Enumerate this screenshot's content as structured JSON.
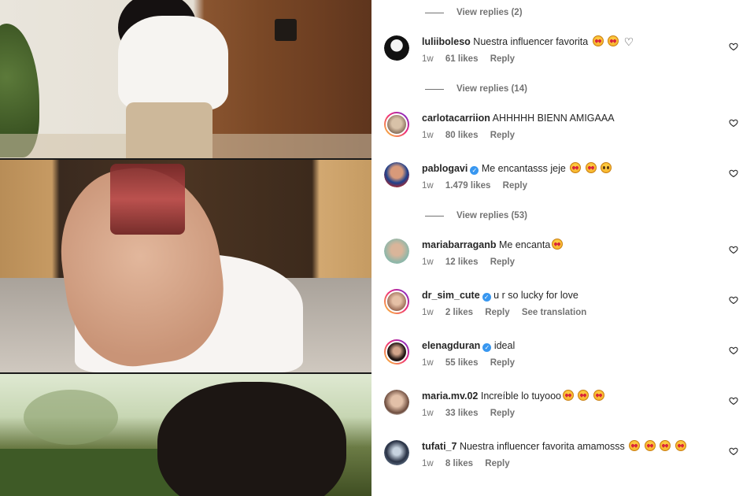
{
  "colors": {
    "text_primary": "#262626",
    "text_secondary": "#737373",
    "verified_blue": "#3897f0",
    "background": "#ffffff"
  },
  "media": {
    "panels": [
      "outfit-standing",
      "perfume-bottle-closeup",
      "garden-blurred"
    ]
  },
  "view_replies_top": "View replies (2)",
  "comments": [
    {
      "username": "luliiboleso",
      "verified": false,
      "text": "Nuestra influencer favorita",
      "emojis": [
        "star-struck",
        "star-struck"
      ],
      "trailing_heart": true,
      "time": "1w",
      "likes": "61 likes",
      "reply": "Reply",
      "view_replies": "View replies (14)"
    },
    {
      "username": "carlotacarriion",
      "verified": false,
      "text": "AHHHHH BIENN AMIGAAA",
      "emojis": [],
      "time": "1w",
      "likes": "80 likes",
      "reply": "Reply"
    },
    {
      "username": "pablogavi",
      "verified": true,
      "text": "Me encantasss jeje",
      "emojis": [
        "star-struck",
        "smiling-hearts",
        "grinning"
      ],
      "time": "1w",
      "likes": "1.479 likes",
      "reply": "Reply",
      "view_replies": "View replies (53)"
    },
    {
      "username": "mariabarraganb",
      "verified": false,
      "text": "Me encanta",
      "emojis": [
        "star-struck"
      ],
      "time": "1w",
      "likes": "12 likes",
      "reply": "Reply"
    },
    {
      "username": "dr_sim_cute",
      "verified": true,
      "text": "u r so lucky for love",
      "emojis": [],
      "time": "1w",
      "likes": "2 likes",
      "reply": "Reply",
      "see_translation": "See translation"
    },
    {
      "username": "elenagduran",
      "verified": true,
      "text": "ideal",
      "emojis": [],
      "time": "1w",
      "likes": "55 likes",
      "reply": "Reply"
    },
    {
      "username": "maria.mv.02",
      "verified": false,
      "text": "Increíble lo tuyooo",
      "emojis": [
        "star-struck",
        "star-struck",
        "star-struck"
      ],
      "time": "1w",
      "likes": "33 likes",
      "reply": "Reply"
    },
    {
      "username": "tufati_7",
      "verified": false,
      "text": "Nuestra influencer favorita amamosss",
      "emojis": [
        "star-struck",
        "star-struck",
        "star-struck",
        "star-struck"
      ],
      "time": "1w",
      "likes": "8 likes",
      "reply": "Reply"
    }
  ]
}
